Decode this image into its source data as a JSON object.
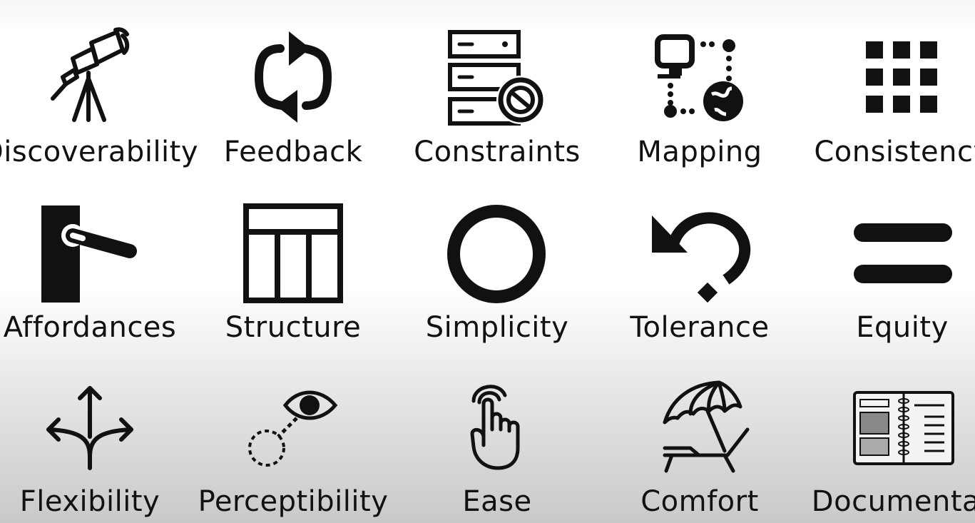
{
  "principles": {
    "row1": [
      "Discoverability",
      "Feedback",
      "Constraints",
      "Mapping",
      "Consistency"
    ],
    "row2": [
      "Affordances",
      "Structure",
      "Simplicity",
      "Tolerance",
      "Equity"
    ],
    "row3": [
      "Flexibility",
      "Perceptibility",
      "Ease",
      "Comfort",
      "Documentation"
    ]
  },
  "icons": {
    "row1": [
      "telescope-icon",
      "refresh-cycle-icon",
      "server-blocked-icon",
      "network-mapping-icon",
      "grid-icon"
    ],
    "row2": [
      "door-handle-icon",
      "layout-structure-icon",
      "circle-icon",
      "undo-icon",
      "equals-icon"
    ],
    "row3": [
      "branching-arrows-icon",
      "eye-icon",
      "touch-hand-icon",
      "beach-lounger-icon",
      "notebook-icon"
    ]
  },
  "colors": {
    "ink": "#111111",
    "background": "#ffffff"
  }
}
